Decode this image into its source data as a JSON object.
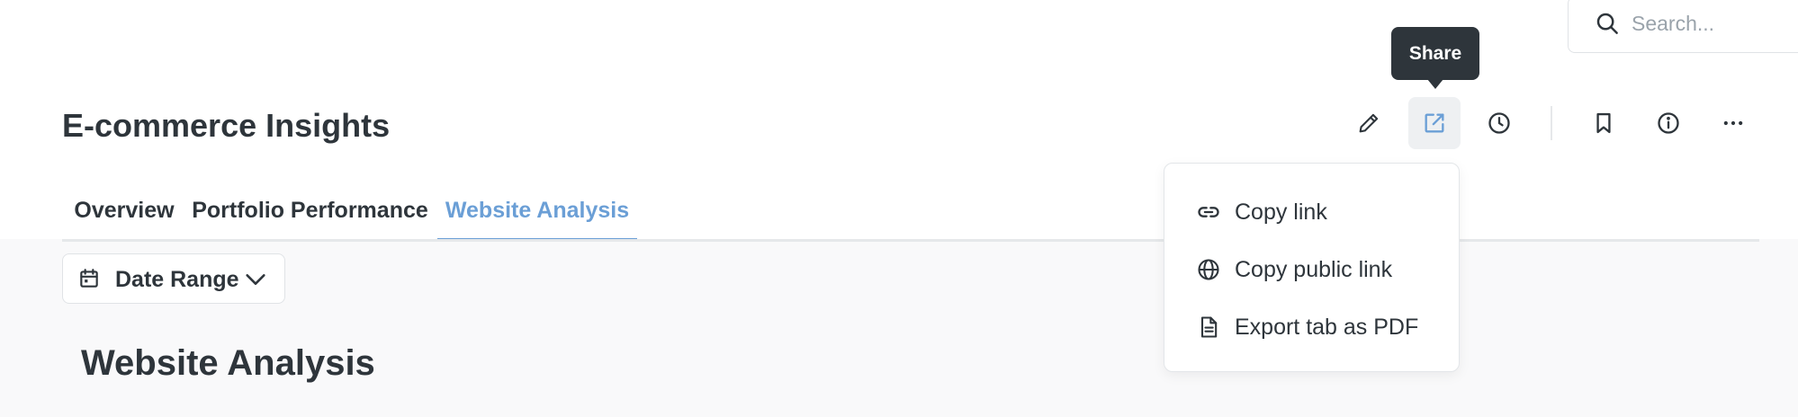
{
  "search": {
    "placeholder": "Search..."
  },
  "dashboard": {
    "title": "E-commerce Insights"
  },
  "tabs": [
    {
      "label": "Overview",
      "active": false
    },
    {
      "label": "Portfolio Performance",
      "active": false
    },
    {
      "label": "Website Analysis",
      "active": true
    }
  ],
  "toolbar": {
    "buttons": [
      {
        "icon": "pencil-icon",
        "name": "edit"
      },
      {
        "icon": "share-icon",
        "name": "share",
        "active": true
      },
      {
        "icon": "clock-icon",
        "name": "history"
      },
      {
        "icon": "bookmark-icon",
        "name": "bookmark"
      },
      {
        "icon": "info-icon",
        "name": "info"
      },
      {
        "icon": "ellipsis-icon",
        "name": "more"
      }
    ]
  },
  "tooltip": {
    "label": "Share"
  },
  "share_menu": {
    "items": [
      {
        "icon": "link-icon",
        "label": "Copy link"
      },
      {
        "icon": "globe-icon",
        "label": "Copy public link"
      },
      {
        "icon": "document-icon",
        "label": "Export tab as PDF"
      }
    ]
  },
  "filters": {
    "date_range_label": "Date Range"
  },
  "section": {
    "heading": "Website Analysis"
  },
  "colors": {
    "accent": "#6b9fd6",
    "text": "#2e353b",
    "tooltip_bg": "#2e353b",
    "content_bg": "#f9f9fa"
  }
}
